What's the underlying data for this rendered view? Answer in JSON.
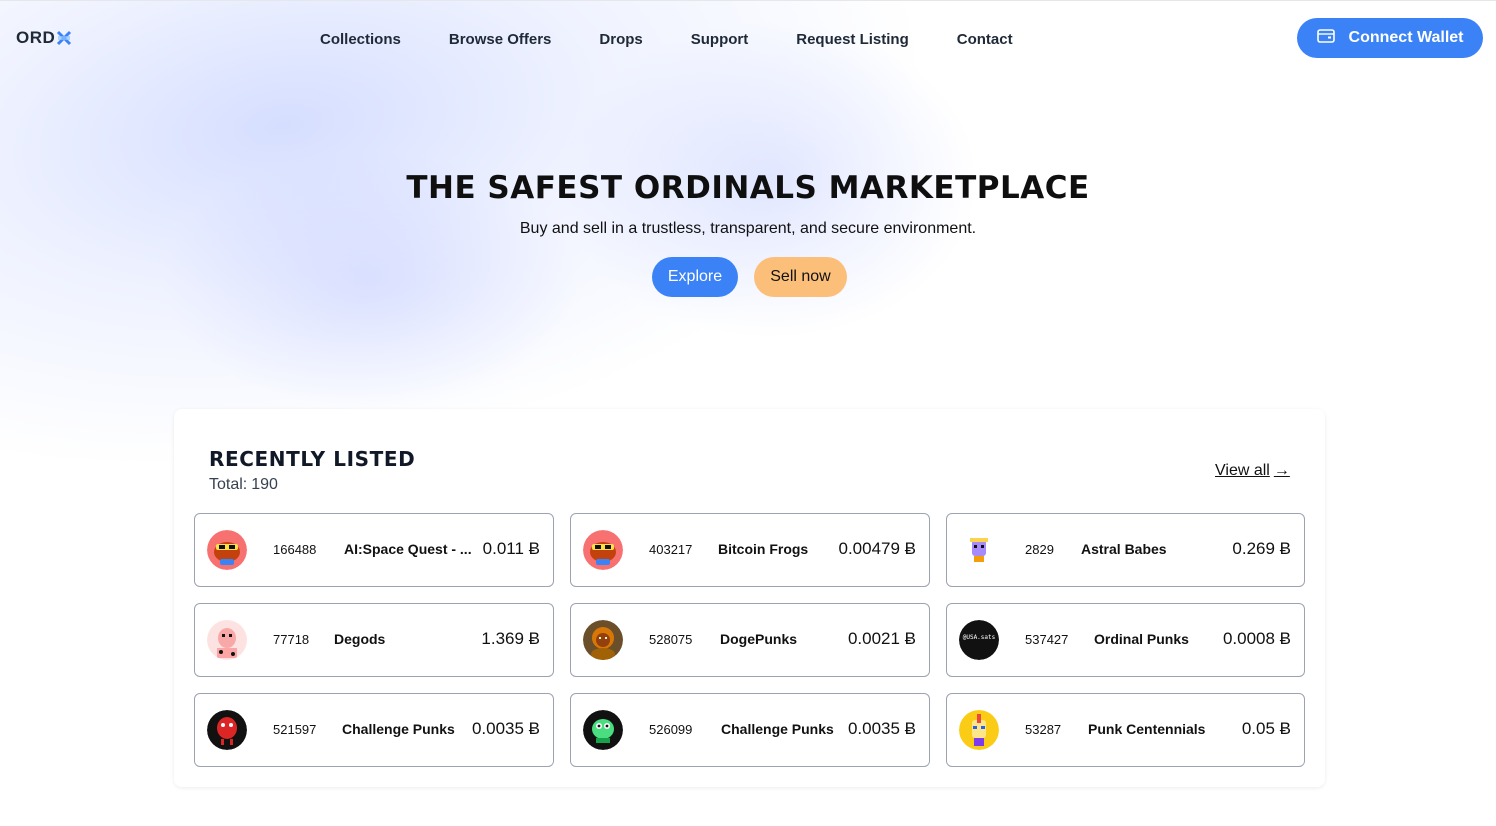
{
  "header": {
    "logo_text": "ORD",
    "nav": [
      {
        "label": "Collections"
      },
      {
        "label": "Browse Offers"
      },
      {
        "label": "Drops"
      },
      {
        "label": "Support"
      },
      {
        "label": "Request Listing"
      },
      {
        "label": "Contact"
      }
    ],
    "connect_label": "Connect Wallet",
    "connect_icon": "wallet-icon"
  },
  "hero": {
    "title": "THE SAFEST ORDINALS MARKETPLACE",
    "subtitle": "Buy and sell in a trustless, transparent, and secure environment.",
    "explore_label": "Explore",
    "sell_label": "Sell now"
  },
  "recent": {
    "title": "RECENTLY LISTED",
    "total_label": "Total:",
    "total": "190",
    "view_all_label": "View all",
    "view_all_arrow": "→",
    "items": [
      {
        "number": "166488",
        "name": "AI:Space Quest - ...",
        "price": "0.011 Ƀ",
        "avatar": "frog-red"
      },
      {
        "number": "403217",
        "name": "Bitcoin Frogs",
        "price": "0.00479 Ƀ",
        "avatar": "frog-red"
      },
      {
        "number": "2829",
        "name": "Astral Babes",
        "price": "0.269 Ƀ",
        "avatar": "babe-pixel"
      },
      {
        "number": "77718",
        "name": "Degods",
        "price": "1.369 Ƀ",
        "avatar": "degod-pink"
      },
      {
        "number": "528075",
        "name": "DogePunks",
        "price": "0.0021 Ƀ",
        "avatar": "doge-art"
      },
      {
        "number": "537427",
        "name": "Ordinal Punks",
        "price": "0.0008 Ƀ",
        "avatar": "black-text"
      },
      {
        "number": "521597",
        "name": "Challenge Punks",
        "price": "0.0035 Ƀ",
        "avatar": "red-creature"
      },
      {
        "number": "526099",
        "name": "Challenge Punks",
        "price": "0.0035 Ƀ",
        "avatar": "green-creature"
      },
      {
        "number": "53287",
        "name": "Punk Centennials",
        "price": "0.05 Ƀ",
        "avatar": "punk-yellow"
      }
    ],
    "black_avatar_text": "@USA.sats"
  },
  "colors": {
    "primary": "#3b82f6",
    "sell": "#fbbf7a"
  }
}
